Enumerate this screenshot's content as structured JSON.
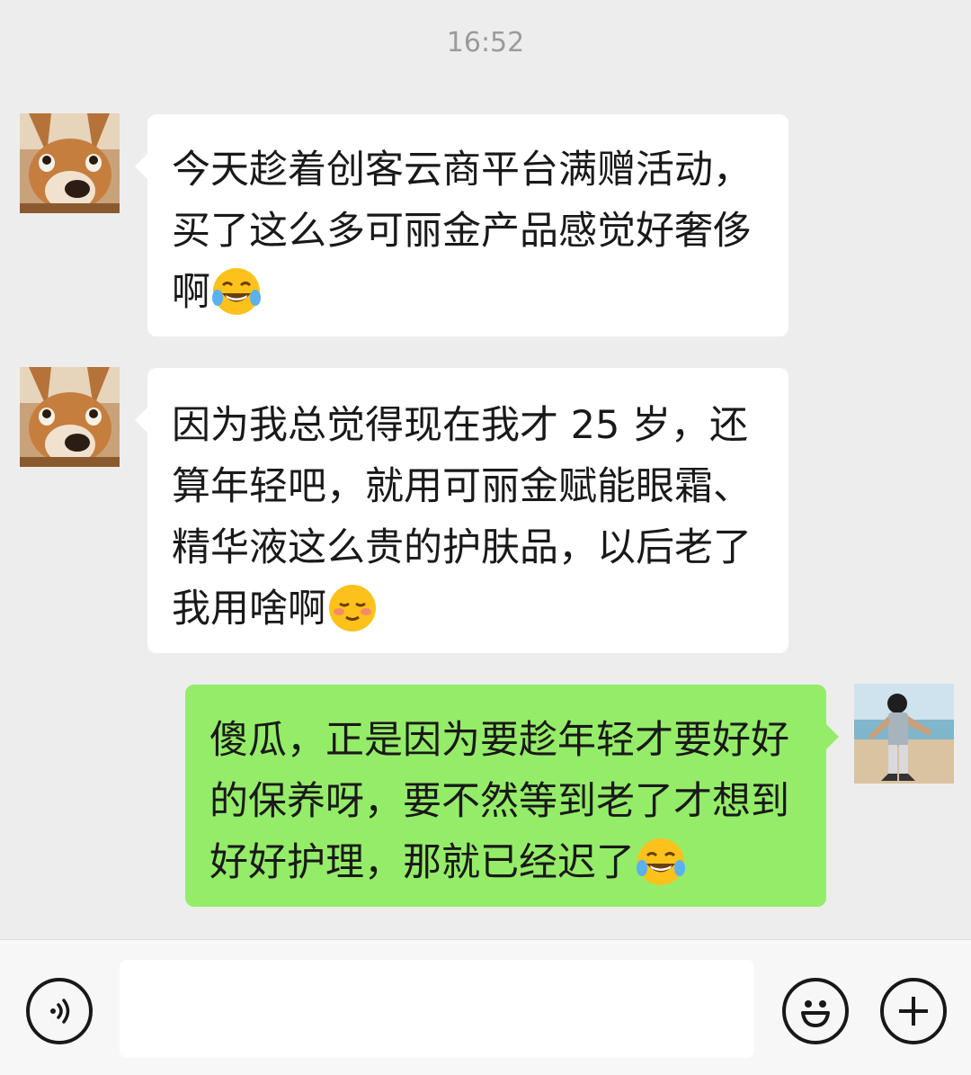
{
  "chat": {
    "timestamp": "16:52",
    "messages": [
      {
        "side": "left",
        "sender_avatar": "corgi-dog-avatar",
        "text": "今天趁着创客云商平台满赠活动，买了这么多可丽金产品感觉好奢侈啊",
        "emoji": "tears-of-joy-emoji"
      },
      {
        "side": "left",
        "sender_avatar": "corgi-dog-avatar",
        "text": "因为我总觉得现在我才 25 岁，还算年轻吧，就用可丽金赋能眼霜、精华液这么贵的护肤品，以后老了我用啥啊",
        "emoji": "shy-smile-emoji"
      },
      {
        "side": "right",
        "sender_avatar": "beach-person-avatar",
        "text": "傻瓜，正是因为要趁年轻才要好好的保养呀，要不然等到老了才想到好好护理，那就已经迟了",
        "emoji": "tears-of-joy-emoji"
      }
    ]
  },
  "bottom_bar": {
    "voice_icon": "voice-icon",
    "input_value": "",
    "emoji_icon": "smiley-icon",
    "plus_icon": "plus-icon"
  },
  "colors": {
    "background": "#ededed",
    "incoming_bubble": "#ffffff",
    "outgoing_bubble": "#95ec69",
    "text": "#191919",
    "timestamp": "#9b9b9b"
  }
}
